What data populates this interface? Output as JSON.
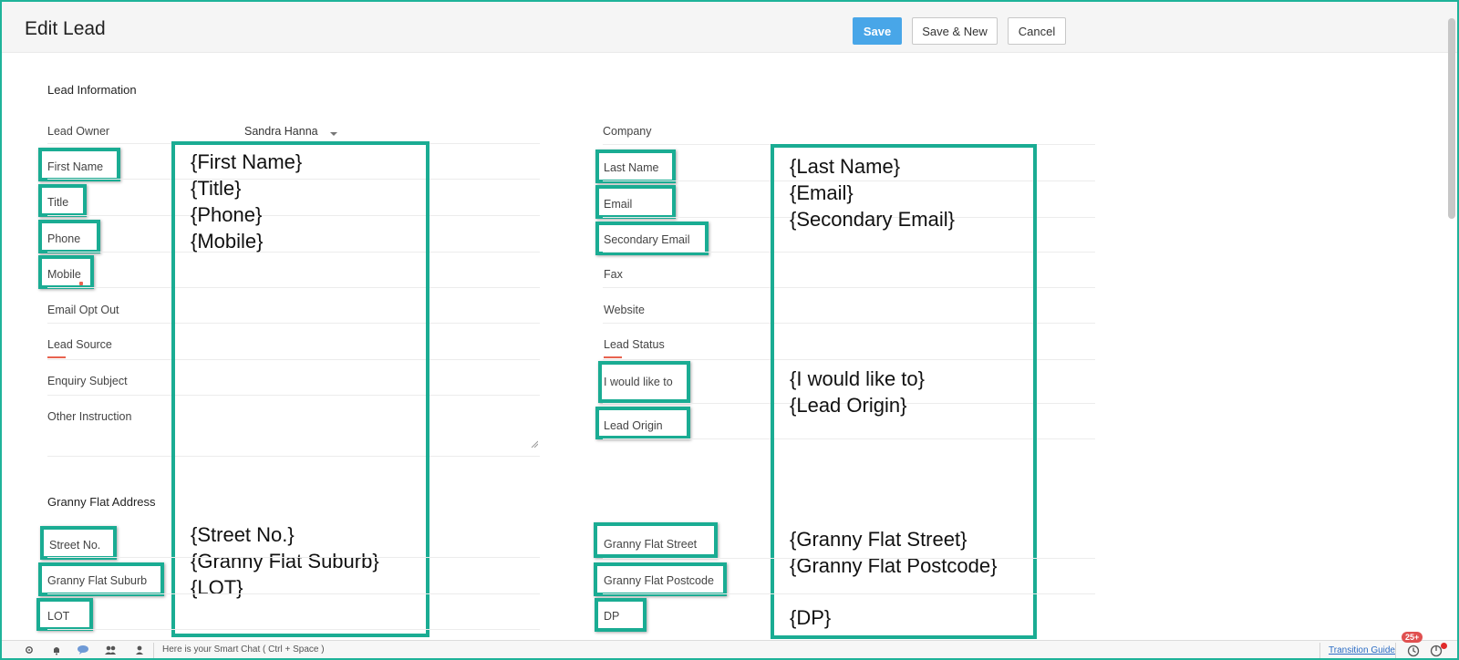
{
  "header": {
    "title": "Edit Lead",
    "save_label": "Save",
    "save_new_label": "Save & New",
    "cancel_label": "Cancel"
  },
  "lead_info": {
    "section_title": "Lead Information",
    "lead_owner_label": "Lead Owner",
    "lead_owner_value": "Sandra Hanna",
    "left_fields": [
      "First Name",
      "Title",
      "Phone",
      "Mobile",
      "Email Opt Out",
      "Lead Source",
      "Enquiry Subject",
      "Other Instruction"
    ],
    "right_fields": [
      "Company",
      "Last Name",
      "Email",
      "Secondary Email",
      "Fax",
      "Website",
      "Lead Status",
      "I would like to",
      "Lead Origin"
    ],
    "left_box_text": "{First Name}\n{Title}\n{Phone}\n{Mobile}",
    "right_box_text_top": "{Last Name}\n{Email}\n{Secondary Email}",
    "right_box_text_mid": "{I would like to}\n{Lead Origin}"
  },
  "address": {
    "section_title": "Granny Flat Address",
    "left_fields": [
      "Street No.",
      "Granny Flat Suburb",
      "LOT"
    ],
    "right_fields": [
      "Granny Flat Street",
      "Granny Flat Postcode",
      "DP"
    ],
    "left_box_text": "{Street No.}\n{Granny Flat Suburb}\n{LOT}",
    "right_box_text_a": "{Granny Flat Street}\n{Granny Flat Postcode}",
    "right_box_text_b": "{DP}"
  },
  "bottombar": {
    "smart_chat": "Here is your Smart Chat ( Ctrl + Space )",
    "transition_guide": "Transition Guide",
    "notification_count": "25+"
  },
  "colors": {
    "highlight": "#1aac93",
    "save_button": "#48a6e8",
    "frame": "#1fb39a"
  }
}
